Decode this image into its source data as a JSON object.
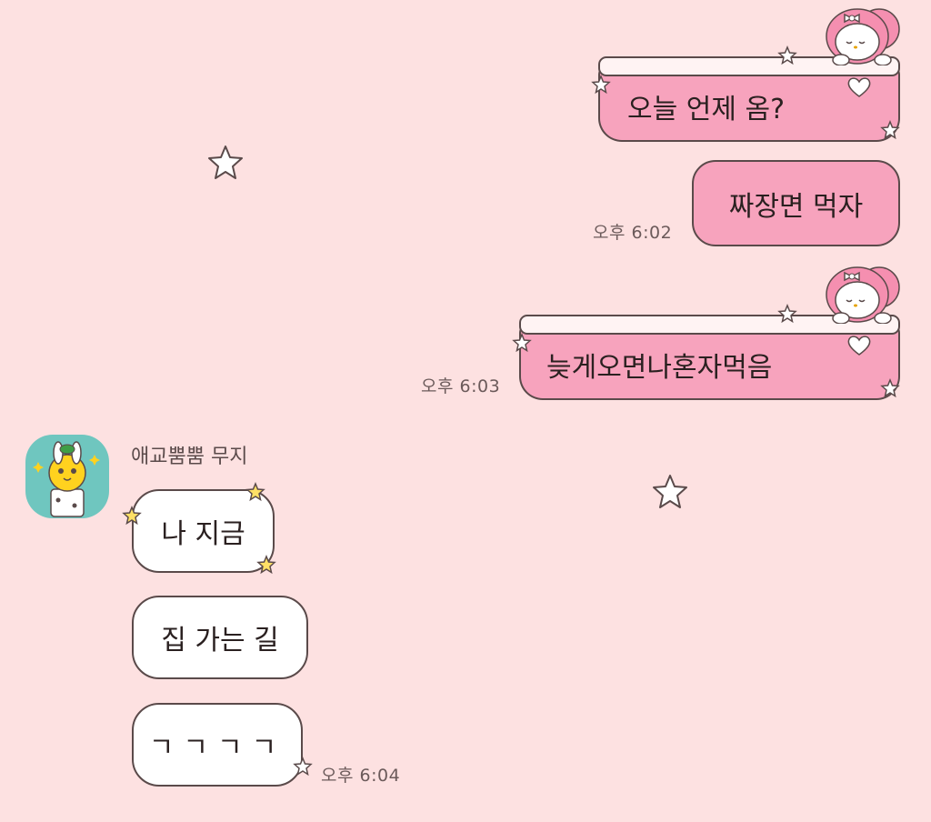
{
  "chat": {
    "messages_out": [
      {
        "text": "오늘 언제 옴?"
      },
      {
        "text": "짜장면 먹자",
        "time": "오후 6:02"
      },
      {
        "text": "늦게오면나혼자먹음",
        "time": "오후 6:03"
      }
    ],
    "sender": {
      "name": "애교뿜뿜 무지"
    },
    "messages_in": [
      {
        "text": "나 지금"
      },
      {
        "text": "집 가는 길"
      },
      {
        "text": "ㄱㄱㄱㄱ",
        "time": "오후 6:04"
      }
    ]
  },
  "icons": {
    "star": "star-icon",
    "heart": "heart-icon",
    "melody": "my-melody-sticker-icon",
    "muzi": "muzi-avatar-icon"
  },
  "colors": {
    "background": "#fde1e1",
    "outgoing_bubble": "#f7a3bd",
    "incoming_bubble": "#ffffff",
    "avatar_bg": "#6fc6bf"
  }
}
